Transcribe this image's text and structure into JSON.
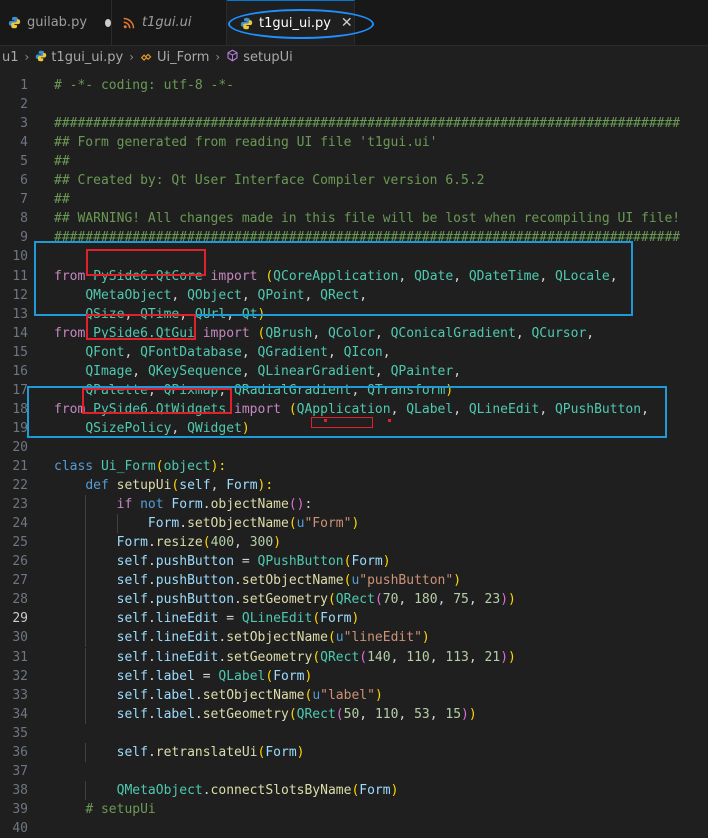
{
  "tabs": [
    {
      "label": "guilab.py",
      "icon": "python-icon",
      "modified": true
    },
    {
      "label": "t1gui.ui",
      "icon": "rss-icon",
      "italic": true
    },
    {
      "label": "t1gui_ui.py",
      "icon": "python-icon",
      "active": true,
      "close": "✕"
    }
  ],
  "breadcrumb": [
    {
      "label": "u1",
      "icon": ""
    },
    {
      "label": "t1gui_ui.py",
      "icon": "python-icon"
    },
    {
      "label": "Ui_Form",
      "icon": "class-icon"
    },
    {
      "label": "setupUi",
      "icon": "method-icon"
    }
  ],
  "current_line": 29,
  "code": [
    {
      "n": "1",
      "t": [
        [
          "c",
          "# -*- coding: utf-8 -*-"
        ]
      ]
    },
    {
      "n": "2",
      "t": []
    },
    {
      "n": "3",
      "t": [
        [
          "c",
          "################################################################################"
        ]
      ]
    },
    {
      "n": "4",
      "t": [
        [
          "c",
          "## Form generated from reading UI file 't1gui.ui'"
        ]
      ]
    },
    {
      "n": "5",
      "t": [
        [
          "c",
          "##"
        ]
      ]
    },
    {
      "n": "6",
      "t": [
        [
          "c",
          "## Created by: Qt User Interface Compiler version 6.5.2"
        ]
      ]
    },
    {
      "n": "7",
      "t": [
        [
          "c",
          "##"
        ]
      ]
    },
    {
      "n": "8",
      "t": [
        [
          "c",
          "## WARNING! All changes made in this file will be lost when recompiling UI file!"
        ]
      ]
    },
    {
      "n": "9",
      "t": [
        [
          "c",
          "################################################################################"
        ]
      ]
    },
    {
      "n": "10",
      "t": []
    },
    {
      "n": "11",
      "t": [
        [
          "k",
          "from "
        ],
        [
          "m",
          "PySide6.QtCore"
        ],
        [
          "k",
          " import "
        ],
        [
          "p",
          "("
        ],
        [
          "cl",
          "QCoreApplication"
        ],
        [
          "x",
          ", "
        ],
        [
          "cl",
          "QDate"
        ],
        [
          "x",
          ", "
        ],
        [
          "cl",
          "QDateTime"
        ],
        [
          "x",
          ", "
        ],
        [
          "cl",
          "QLocale"
        ],
        [
          "x",
          ","
        ]
      ]
    },
    {
      "n": "12",
      "t": [
        [
          "x",
          "    "
        ],
        [
          "cl",
          "QMetaObject"
        ],
        [
          "x",
          ", "
        ],
        [
          "cl",
          "QObject"
        ],
        [
          "x",
          ", "
        ],
        [
          "cl",
          "QPoint"
        ],
        [
          "x",
          ", "
        ],
        [
          "cl",
          "QRect"
        ],
        [
          "x",
          ","
        ]
      ]
    },
    {
      "n": "13",
      "t": [
        [
          "x",
          "    "
        ],
        [
          "cl",
          "QSize"
        ],
        [
          "x",
          ", "
        ],
        [
          "cl",
          "QTime"
        ],
        [
          "x",
          ", "
        ],
        [
          "cl",
          "QUrl"
        ],
        [
          "x",
          ", "
        ],
        [
          "cl",
          "Qt"
        ],
        [
          "p",
          ")"
        ]
      ]
    },
    {
      "n": "14",
      "t": [
        [
          "k",
          "from "
        ],
        [
          "m",
          "PySide6.QtGui"
        ],
        [
          "k",
          " import "
        ],
        [
          "p",
          "("
        ],
        [
          "cl",
          "QBrush"
        ],
        [
          "x",
          ", "
        ],
        [
          "cl",
          "QColor"
        ],
        [
          "x",
          ", "
        ],
        [
          "cl",
          "QConicalGradient"
        ],
        [
          "x",
          ", "
        ],
        [
          "cl",
          "QCursor"
        ],
        [
          "x",
          ","
        ]
      ]
    },
    {
      "n": "15",
      "t": [
        [
          "x",
          "    "
        ],
        [
          "cl",
          "QFont"
        ],
        [
          "x",
          ", "
        ],
        [
          "cl",
          "QFontDatabase"
        ],
        [
          "x",
          ", "
        ],
        [
          "cl",
          "QGradient"
        ],
        [
          "x",
          ", "
        ],
        [
          "cl",
          "QIcon"
        ],
        [
          "x",
          ","
        ]
      ]
    },
    {
      "n": "16",
      "t": [
        [
          "x",
          "    "
        ],
        [
          "cl",
          "QImage"
        ],
        [
          "x",
          ", "
        ],
        [
          "cl",
          "QKeySequence"
        ],
        [
          "x",
          ", "
        ],
        [
          "cl",
          "QLinearGradient"
        ],
        [
          "x",
          ", "
        ],
        [
          "cl",
          "QPainter"
        ],
        [
          "x",
          ","
        ]
      ]
    },
    {
      "n": "17",
      "t": [
        [
          "x",
          "    "
        ],
        [
          "cl",
          "QPalette"
        ],
        [
          "x",
          ", "
        ],
        [
          "cl",
          "QPixmap"
        ],
        [
          "x",
          ", "
        ],
        [
          "cl",
          "QRadialGradient"
        ],
        [
          "x",
          ", "
        ],
        [
          "cl",
          "QTransform"
        ],
        [
          "p",
          ")"
        ]
      ]
    },
    {
      "n": "18",
      "t": [
        [
          "k",
          "from "
        ],
        [
          "m",
          "PySide6.QtWidgets"
        ],
        [
          "k",
          " import "
        ],
        [
          "p",
          "("
        ],
        [
          "cl",
          "QApplication"
        ],
        [
          "x",
          ", "
        ],
        [
          "cl",
          "QLabel"
        ],
        [
          "x",
          ", "
        ],
        [
          "cl",
          "QLineEdit"
        ],
        [
          "x",
          ", "
        ],
        [
          "cl",
          "QPushButton"
        ],
        [
          "x",
          ","
        ]
      ]
    },
    {
      "n": "19",
      "t": [
        [
          "x",
          "    "
        ],
        [
          "cl",
          "QSizePolicy"
        ],
        [
          "x",
          ", "
        ],
        [
          "cl",
          "QWidget"
        ],
        [
          "p",
          ")"
        ]
      ]
    },
    {
      "n": "20",
      "t": []
    },
    {
      "n": "21",
      "t": [
        [
          "d",
          "class "
        ],
        [
          "cl",
          "Ui_Form"
        ],
        [
          "p",
          "("
        ],
        [
          "cl",
          "object"
        ],
        [
          "p",
          "):"
        ]
      ]
    },
    {
      "n": "22",
      "t": [
        [
          "x",
          "    "
        ],
        [
          "d",
          "def "
        ],
        [
          "f",
          "setupUi"
        ],
        [
          "p",
          "("
        ],
        [
          "v",
          "self"
        ],
        [
          "x",
          ", "
        ],
        [
          "v",
          "Form"
        ],
        [
          "p",
          "):"
        ]
      ]
    },
    {
      "n": "23",
      "t": [
        [
          "x",
          "        "
        ],
        [
          "k",
          "if "
        ],
        [
          "d",
          "not "
        ],
        [
          "v",
          "Form"
        ],
        [
          "x",
          "."
        ],
        [
          "f",
          "objectName"
        ],
        [
          "p2",
          "()"
        ],
        [
          "x",
          ":"
        ]
      ]
    },
    {
      "n": "24",
      "t": [
        [
          "x",
          "            "
        ],
        [
          "v",
          "Form"
        ],
        [
          "x",
          "."
        ],
        [
          "f",
          "setObjectName"
        ],
        [
          "p",
          "("
        ],
        [
          "d",
          "u"
        ],
        [
          "s",
          "\"Form\""
        ],
        [
          "p",
          ")"
        ]
      ]
    },
    {
      "n": "25",
      "t": [
        [
          "x",
          "        "
        ],
        [
          "v",
          "Form"
        ],
        [
          "x",
          "."
        ],
        [
          "f",
          "resize"
        ],
        [
          "p",
          "("
        ],
        [
          "n",
          "400"
        ],
        [
          "x",
          ", "
        ],
        [
          "n",
          "300"
        ],
        [
          "p",
          ")"
        ]
      ]
    },
    {
      "n": "26",
      "t": [
        [
          "x",
          "        "
        ],
        [
          "v",
          "self"
        ],
        [
          "x",
          "."
        ],
        [
          "v",
          "pushButton"
        ],
        [
          "x",
          " = "
        ],
        [
          "cl",
          "QPushButton"
        ],
        [
          "p",
          "("
        ],
        [
          "v",
          "Form"
        ],
        [
          "p",
          ")"
        ]
      ]
    },
    {
      "n": "27",
      "t": [
        [
          "x",
          "        "
        ],
        [
          "v",
          "self"
        ],
        [
          "x",
          "."
        ],
        [
          "v",
          "pushButton"
        ],
        [
          "x",
          "."
        ],
        [
          "f",
          "setObjectName"
        ],
        [
          "p",
          "("
        ],
        [
          "d",
          "u"
        ],
        [
          "s",
          "\"pushButton\""
        ],
        [
          "p",
          ")"
        ]
      ]
    },
    {
      "n": "28",
      "t": [
        [
          "x",
          "        "
        ],
        [
          "v",
          "self"
        ],
        [
          "x",
          "."
        ],
        [
          "v",
          "pushButton"
        ],
        [
          "x",
          "."
        ],
        [
          "f",
          "setGeometry"
        ],
        [
          "p",
          "("
        ],
        [
          "cl",
          "QRect"
        ],
        [
          "p2",
          "("
        ],
        [
          "n",
          "70"
        ],
        [
          "x",
          ", "
        ],
        [
          "n",
          "180"
        ],
        [
          "x",
          ", "
        ],
        [
          "n",
          "75"
        ],
        [
          "x",
          ", "
        ],
        [
          "n",
          "23"
        ],
        [
          "p2",
          ")"
        ],
        [
          "p",
          ")"
        ]
      ]
    },
    {
      "n": "29",
      "t": [
        [
          "x",
          "        "
        ],
        [
          "v",
          "self"
        ],
        [
          "x",
          "."
        ],
        [
          "v",
          "lineEdit"
        ],
        [
          "x",
          " = "
        ],
        [
          "cl",
          "QLineEdit"
        ],
        [
          "p",
          "("
        ],
        [
          "v",
          "Form"
        ],
        [
          "p",
          ")"
        ]
      ]
    },
    {
      "n": "30",
      "t": [
        [
          "x",
          "        "
        ],
        [
          "v",
          "self"
        ],
        [
          "x",
          "."
        ],
        [
          "v",
          "lineEdit"
        ],
        [
          "x",
          "."
        ],
        [
          "f",
          "setObjectName"
        ],
        [
          "p",
          "("
        ],
        [
          "d",
          "u"
        ],
        [
          "s",
          "\"lineEdit\""
        ],
        [
          "p",
          ")"
        ]
      ]
    },
    {
      "n": "31",
      "t": [
        [
          "x",
          "        "
        ],
        [
          "v",
          "self"
        ],
        [
          "x",
          "."
        ],
        [
          "v",
          "lineEdit"
        ],
        [
          "x",
          "."
        ],
        [
          "f",
          "setGeometry"
        ],
        [
          "p",
          "("
        ],
        [
          "cl",
          "QRect"
        ],
        [
          "p2",
          "("
        ],
        [
          "n",
          "140"
        ],
        [
          "x",
          ", "
        ],
        [
          "n",
          "110"
        ],
        [
          "x",
          ", "
        ],
        [
          "n",
          "113"
        ],
        [
          "x",
          ", "
        ],
        [
          "n",
          "21"
        ],
        [
          "p2",
          ")"
        ],
        [
          "p",
          ")"
        ]
      ]
    },
    {
      "n": "32",
      "t": [
        [
          "x",
          "        "
        ],
        [
          "v",
          "self"
        ],
        [
          "x",
          "."
        ],
        [
          "v",
          "label"
        ],
        [
          "x",
          " = "
        ],
        [
          "cl",
          "QLabel"
        ],
        [
          "p",
          "("
        ],
        [
          "v",
          "Form"
        ],
        [
          "p",
          ")"
        ]
      ]
    },
    {
      "n": "33",
      "t": [
        [
          "x",
          "        "
        ],
        [
          "v",
          "self"
        ],
        [
          "x",
          "."
        ],
        [
          "v",
          "label"
        ],
        [
          "x",
          "."
        ],
        [
          "f",
          "setObjectName"
        ],
        [
          "p",
          "("
        ],
        [
          "d",
          "u"
        ],
        [
          "s",
          "\"label\""
        ],
        [
          "p",
          ")"
        ]
      ]
    },
    {
      "n": "34",
      "t": [
        [
          "x",
          "        "
        ],
        [
          "v",
          "self"
        ],
        [
          "x",
          "."
        ],
        [
          "v",
          "label"
        ],
        [
          "x",
          "."
        ],
        [
          "f",
          "setGeometry"
        ],
        [
          "p",
          "("
        ],
        [
          "cl",
          "QRect"
        ],
        [
          "p2",
          "("
        ],
        [
          "n",
          "50"
        ],
        [
          "x",
          ", "
        ],
        [
          "n",
          "110"
        ],
        [
          "x",
          ", "
        ],
        [
          "n",
          "53"
        ],
        [
          "x",
          ", "
        ],
        [
          "n",
          "15"
        ],
        [
          "p2",
          ")"
        ],
        [
          "p",
          ")"
        ]
      ]
    },
    {
      "n": "35",
      "t": []
    },
    {
      "n": "36",
      "t": [
        [
          "x",
          "        "
        ],
        [
          "v",
          "self"
        ],
        [
          "x",
          "."
        ],
        [
          "f",
          "retranslateUi"
        ],
        [
          "p",
          "("
        ],
        [
          "v",
          "Form"
        ],
        [
          "p",
          ")"
        ]
      ]
    },
    {
      "n": "37",
      "t": []
    },
    {
      "n": "38",
      "t": [
        [
          "x",
          "        "
        ],
        [
          "cl",
          "QMetaObject"
        ],
        [
          "x",
          "."
        ],
        [
          "f",
          "connectSlotsByName"
        ],
        [
          "p",
          "("
        ],
        [
          "v",
          "Form"
        ],
        [
          "p",
          ")"
        ]
      ]
    },
    {
      "n": "39",
      "t": [
        [
          "x",
          "    "
        ],
        [
          "c",
          "# setupUi"
        ]
      ]
    },
    {
      "n": "40",
      "t": []
    }
  ]
}
